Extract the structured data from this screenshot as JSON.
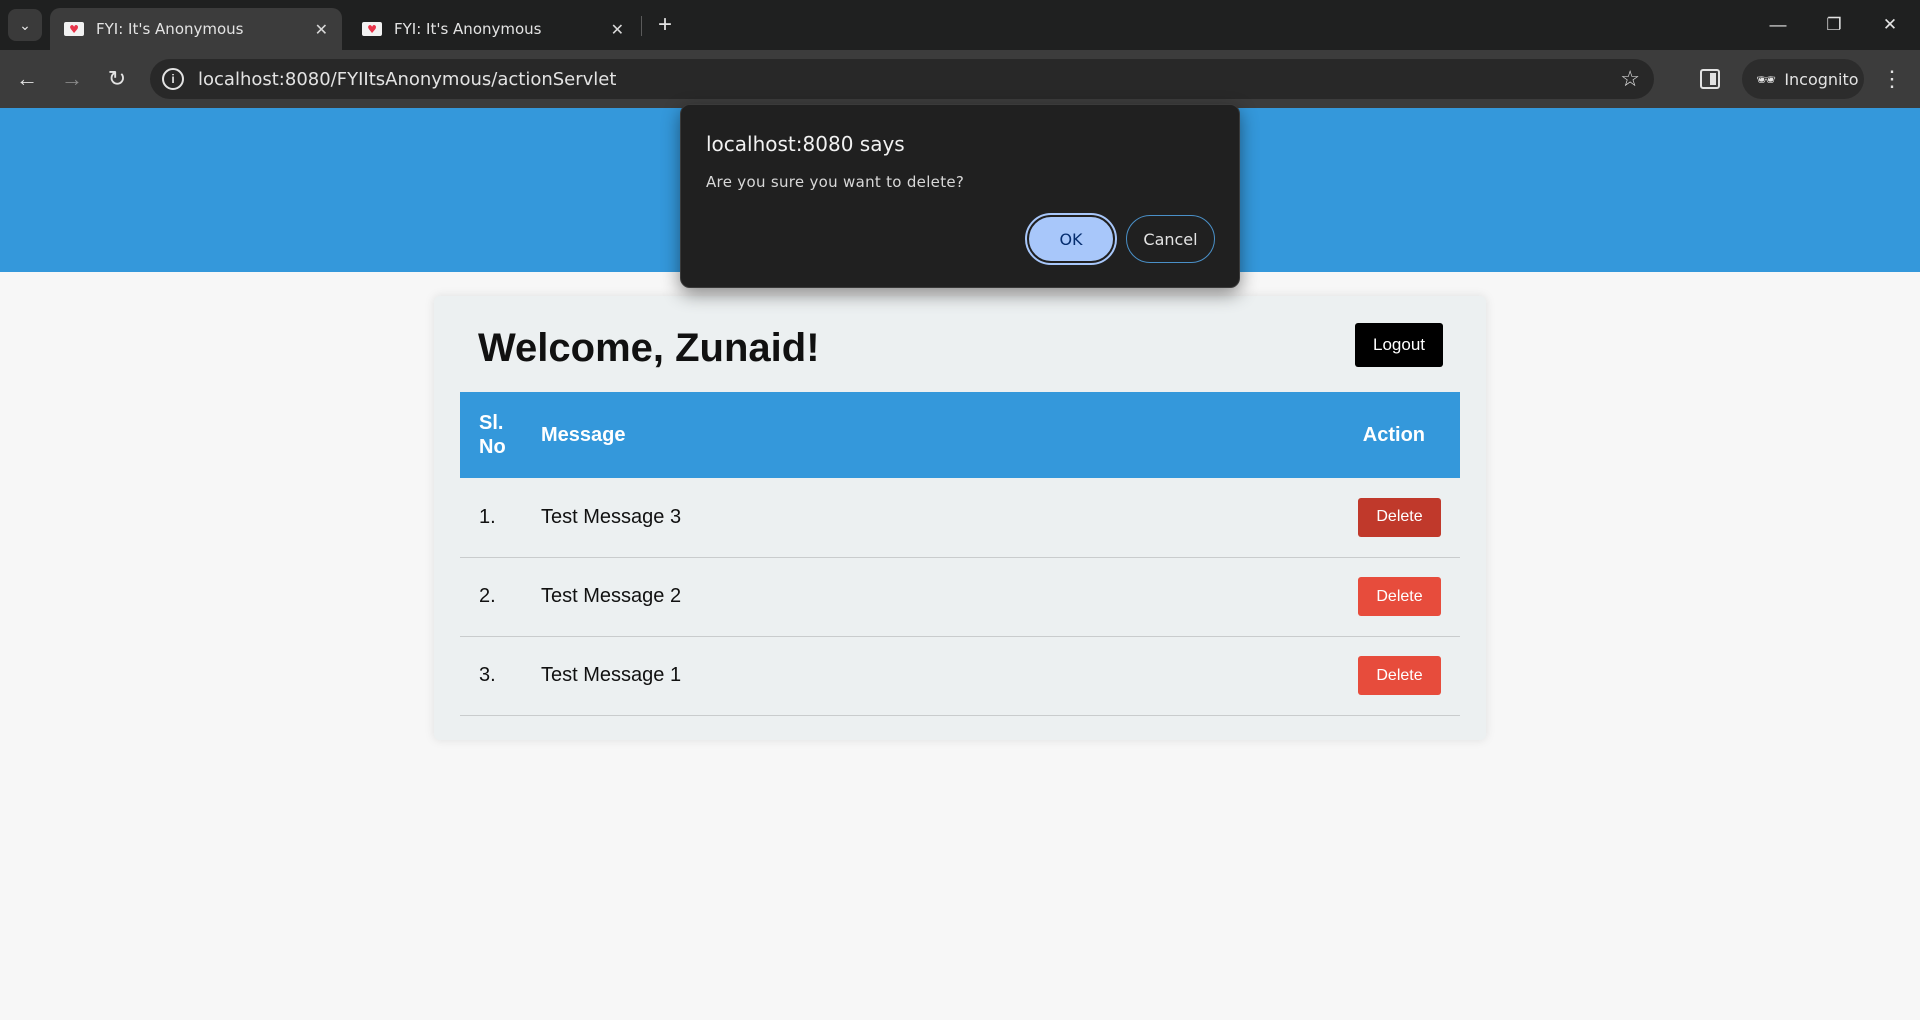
{
  "browser": {
    "tabs": [
      {
        "title": "FYI: It's Anonymous",
        "active": true
      },
      {
        "title": "FYI: It's Anonymous",
        "active": false
      }
    ],
    "url": "localhost:8080/FYIItsAnonymous/actionServlet",
    "incognito_label": "Incognito"
  },
  "page": {
    "welcome": "Welcome, Zunaid!",
    "logout_label": "Logout",
    "table": {
      "headers": {
        "no": "Sl. No",
        "message": "Message",
        "action": "Action"
      },
      "rows": [
        {
          "no": "1.",
          "message": "Test Message 3",
          "action": "Delete"
        },
        {
          "no": "2.",
          "message": "Test Message 2",
          "action": "Delete"
        },
        {
          "no": "3.",
          "message": "Test Message 1",
          "action": "Delete"
        }
      ]
    },
    "colors": {
      "header_blue": "#3498db",
      "delete_red": "#e74c3c",
      "delete_hover": "#c0392b"
    }
  },
  "dialog": {
    "title": "localhost:8080 says",
    "message": "Are you sure you want to delete?",
    "ok_label": "OK",
    "cancel_label": "Cancel"
  }
}
